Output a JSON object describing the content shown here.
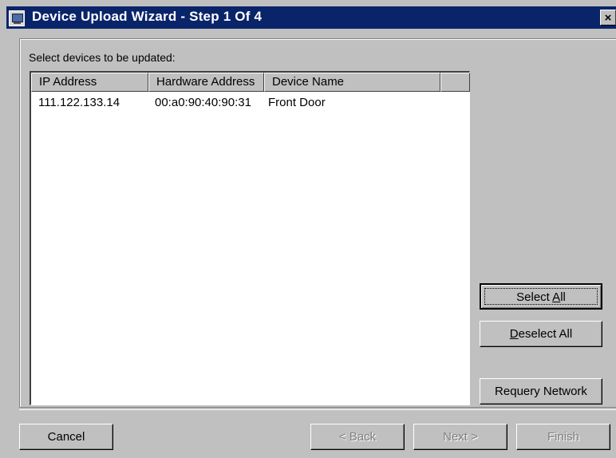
{
  "window": {
    "title": "Device Upload Wizard - Step 1 Of 4",
    "close_glyph": "×"
  },
  "main": {
    "prompt": "Select devices to be updated:",
    "columns": [
      "IP Address",
      "Hardware Address",
      "Device Name",
      ""
    ],
    "rows": [
      {
        "ip": "111.122.133.14",
        "hw": "00:a0:90:40:90:31",
        "name": "Front Door"
      }
    ]
  },
  "side_buttons": {
    "select_all_pre": "Select ",
    "select_all_mn": "A",
    "select_all_post": "ll",
    "deselect_all_mn": "D",
    "deselect_all_post": "eselect All",
    "requery": "Requery Network"
  },
  "footer": {
    "cancel": "Cancel",
    "back": "< Back",
    "next": "Next >",
    "finish": "Finish"
  },
  "colors": {
    "titlebar": "#0a246a",
    "face": "#c0c0c0",
    "disabled_text": "#808080"
  }
}
